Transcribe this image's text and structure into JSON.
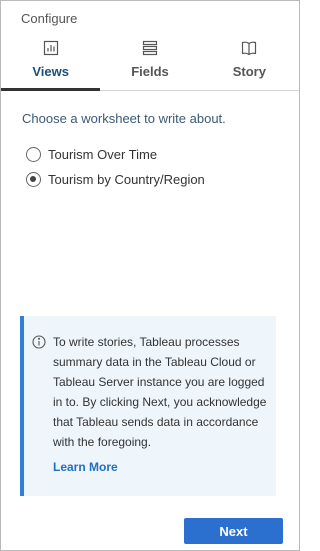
{
  "panel": {
    "title": "Configure"
  },
  "tabs": [
    {
      "label": "Views",
      "icon": "bar-chart-icon",
      "active": true
    },
    {
      "label": "Fields",
      "icon": "list-icon",
      "active": false
    },
    {
      "label": "Story",
      "icon": "book-icon",
      "active": false
    }
  ],
  "prompt": "Choose a worksheet to write about.",
  "worksheets": [
    {
      "label": "Tourism Over Time",
      "selected": false
    },
    {
      "label": "Tourism by Country/Region",
      "selected": true
    }
  ],
  "info": {
    "icon": "info-icon",
    "text": "To write stories, Tableau processes summary data in the Tableau Cloud or Tableau Server instance you are logged in to. By clicking Next, you acknowledge that Tableau sends data in accordance with the foregoing.",
    "learn_more": "Learn More"
  },
  "next_button": "Next",
  "colors": {
    "accent": "#2b6fcf",
    "info_border": "#2f7fd8",
    "info_background": "#eef5fb",
    "active_tab_label": "#1f4e79",
    "link": "#1f6fc5"
  }
}
